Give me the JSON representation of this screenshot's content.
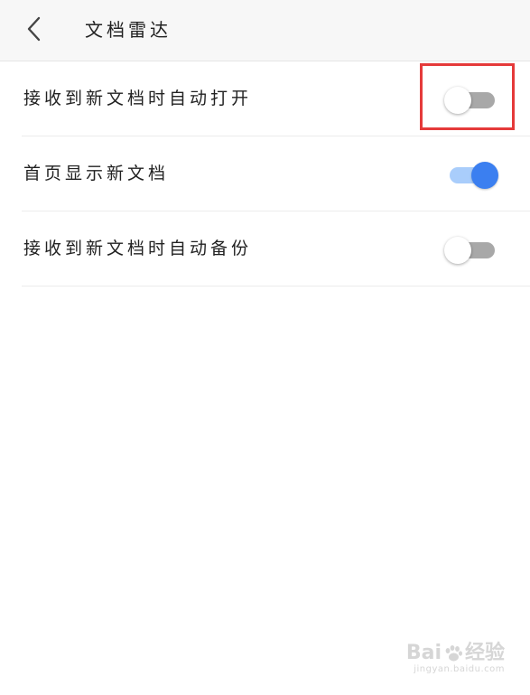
{
  "header": {
    "title": "文档雷达",
    "back_icon": "chevron-left-icon"
  },
  "settings": [
    {
      "label": "接收到新文档时自动打开",
      "enabled": false
    },
    {
      "label": "首页显示新文档",
      "enabled": true
    },
    {
      "label": "接收到新文档时自动备份",
      "enabled": false
    }
  ],
  "colors": {
    "accent": "#3b7ff0",
    "highlight": "#e53a3a",
    "toggle_off_track": "#a8a8a8",
    "toggle_on_track": "#a9cdfb"
  },
  "watermark": {
    "brand_left": "Bai",
    "brand_right": "经验",
    "url": "jingyan.baidu.com"
  }
}
